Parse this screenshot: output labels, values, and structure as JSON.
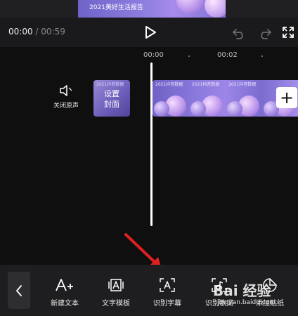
{
  "preview": {
    "title": "2021美好生活报告"
  },
  "player": {
    "current_time": "00:00",
    "separator": "/",
    "total_time": "00:59"
  },
  "timeline": {
    "ruler_labels": [
      "00:00",
      "00:02"
    ],
    "mute_label": "关闭原声",
    "cover_top": "2021抖音数据",
    "cover_label_line1": "设置",
    "cover_label_line2": "封面",
    "clip_frame_label": "2021抖音数据",
    "add_label": "+"
  },
  "toolbar": {
    "items": [
      {
        "label": "新建文本",
        "icon": "text-add-icon"
      },
      {
        "label": "文字模板",
        "icon": "text-template-icon"
      },
      {
        "label": "识别字幕",
        "icon": "subtitle-recognize-icon"
      },
      {
        "label": "识别歌词",
        "icon": "lyrics-recognize-icon"
      },
      {
        "label": "添加贴纸",
        "icon": "sticker-icon"
      }
    ]
  },
  "watermark": {
    "logo": "Bai 经验",
    "url": "jingyan.baidu.com"
  },
  "colors": {
    "background": "#1a1a1c",
    "timeline_bg": "#0f0f10",
    "arrow": "#e02020",
    "clip_purple": "#8b79dd"
  }
}
